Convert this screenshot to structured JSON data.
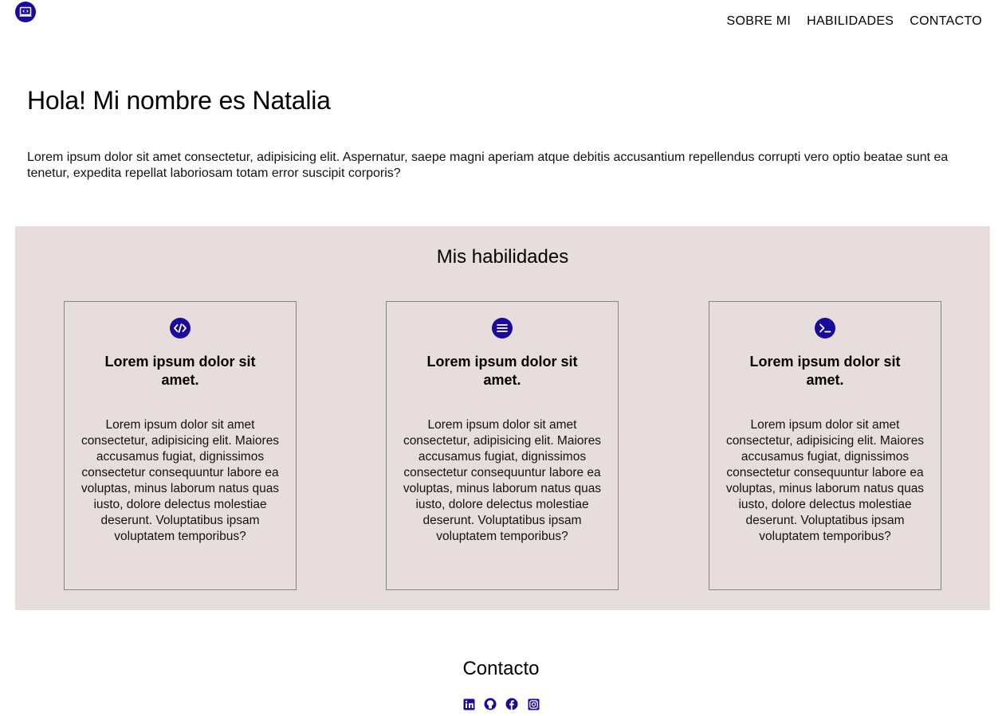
{
  "colors": {
    "accent": "#1a0a9b",
    "skills_background": "#e8dddd",
    "card_border": "#8c8484",
    "text": "#000000"
  },
  "header": {
    "logo_icon": "laptop-code-icon",
    "nav": [
      {
        "label": "SOBRE MI"
      },
      {
        "label": "HABILIDADES"
      },
      {
        "label": "CONTACTO"
      }
    ]
  },
  "hero": {
    "title": "Hola! Mi nombre es Natalia",
    "text": "Lorem ipsum dolor sit amet consectetur, adipisicing elit. Aspernatur, saepe magni aperiam atque debitis accusantium repellendus corrupti vero optio beatae sunt ea tenetur, expedita repellat laboriosam totam error suscipit corporis?"
  },
  "skills": {
    "title": "Mis habilidades",
    "cards": [
      {
        "icon": "code-icon",
        "title": "Lorem ipsum dolor sit amet.",
        "text": "Lorem ipsum dolor sit amet consectetur, adipisicing elit. Maiores accusamus fugiat, dignissimos consectetur consequuntur labore ea voluptas, minus laborum natus quas iusto, dolore delectus molestiae deserunt. Voluptatibus ipsam voluptatem temporibus?"
      },
      {
        "icon": "list-icon",
        "title": "Lorem ipsum dolor sit amet.",
        "text": "Lorem ipsum dolor sit amet consectetur, adipisicing elit. Maiores accusamus fugiat, dignissimos consectetur consequuntur labore ea voluptas, minus laborum natus quas iusto, dolore delectus molestiae deserunt. Voluptatibus ipsam voluptatem temporibus?"
      },
      {
        "icon": "terminal-icon",
        "title": "Lorem ipsum dolor sit amet.",
        "text": "Lorem ipsum dolor sit amet consectetur, adipisicing elit. Maiores accusamus fugiat, dignissimos consectetur consequuntur labore ea voluptas, minus laborum natus quas iusto, dolore delectus molestiae deserunt. Voluptatibus ipsam voluptatem temporibus?"
      }
    ]
  },
  "contact": {
    "title": "Contacto",
    "social_icons": [
      "linkedin-icon",
      "github-icon",
      "facebook-icon",
      "instagram-icon"
    ]
  }
}
